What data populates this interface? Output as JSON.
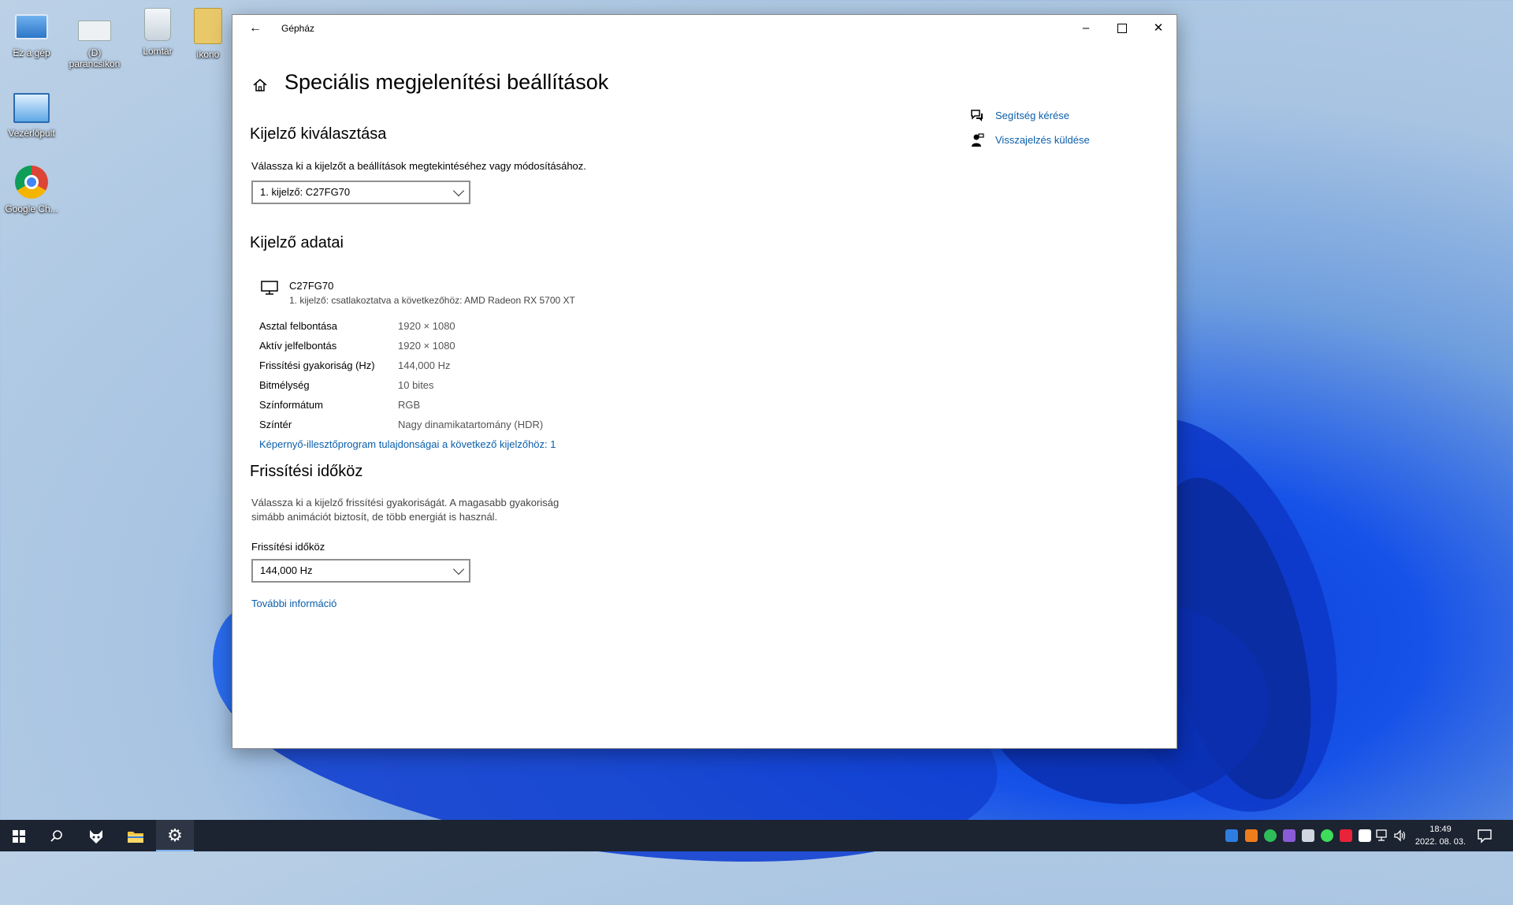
{
  "desktop": {
    "icons": [
      {
        "label": "Ez a gép"
      },
      {
        "label": "(D)\nparancsikon"
      },
      {
        "label": "Lomtár"
      },
      {
        "label": "ikono"
      },
      {
        "label": "Vezérlőpult"
      },
      {
        "label": "Google Ch..."
      }
    ]
  },
  "window": {
    "title": "Gépház",
    "page_title": "Speciális megjelenítési beállítások",
    "select_display": {
      "heading": "Kijelző kiválasztása",
      "description": "Válassza ki a kijelzőt a beállítások megtekintéséhez vagy módosításához.",
      "selected": "1. kijelző: C27FG70"
    },
    "display_info": {
      "heading": "Kijelző adatai",
      "monitor_name": "C27FG70",
      "monitor_sub": "1. kijelző: csatlakoztatva a következőhöz: AMD Radeon RX 5700 XT",
      "rows": [
        {
          "label": "Asztal felbontása",
          "value": "1920 × 1080"
        },
        {
          "label": "Aktív jelfelbontás",
          "value": "1920 × 1080"
        },
        {
          "label": "Frissítési gyakoriság (Hz)",
          "value": "144,000 Hz"
        },
        {
          "label": "Bitmélység",
          "value": "10 bites"
        },
        {
          "label": "Színformátum",
          "value": "RGB"
        },
        {
          "label": "Színtér",
          "value": "Nagy dinamikatartomány (HDR)"
        }
      ],
      "adapter_link": "Képernyő-illesztőprogram tulajdonságai a következő kijelzőhöz: 1"
    },
    "refresh": {
      "heading": "Frissítési időköz",
      "description_line1": "Válassza ki a kijelző frissítési gyakoriságát. A magasabb gyakoriság",
      "description_line2": "simább animációt biztosít, de több energiát is használ.",
      "field_label": "Frissítési időköz",
      "selected": "144,000 Hz",
      "more_info": "További információ"
    },
    "side_links": {
      "help": "Segítség kérése",
      "feedback": "Visszajelzés küldése"
    }
  },
  "taskbar": {
    "time": "18:49",
    "date": "2022. 08. 03."
  }
}
